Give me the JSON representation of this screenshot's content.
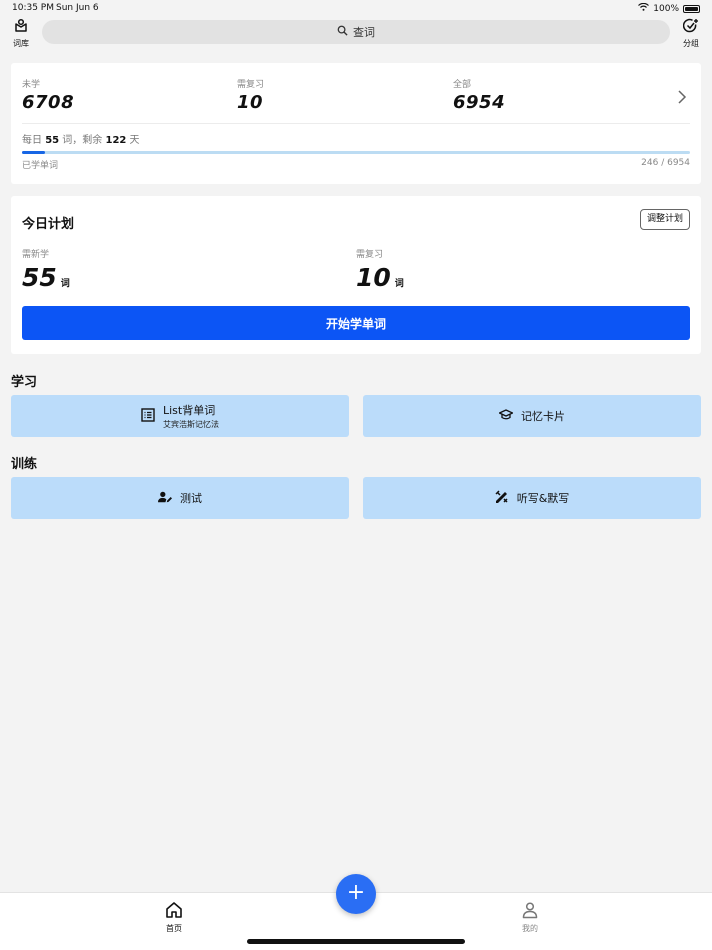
{
  "status": {
    "time": "10:35 PM",
    "date": "Sun Jun 6",
    "battery": "100%"
  },
  "topbar": {
    "left_label": "词库",
    "search_placeholder": "查词",
    "right_label": "分组"
  },
  "stats": {
    "unlearned_label": "未学",
    "unlearned_value": "6708",
    "review_label": "需复习",
    "review_value": "10",
    "total_label": "全部",
    "total_value": "6954",
    "daily_prefix": "每日",
    "daily_count": "55",
    "daily_mid": "词，剩余",
    "days_left": "122",
    "daily_suffix": "天",
    "learned_label": "已学单词",
    "learned_count": "246 / 6954",
    "progress_fraction": 0.035
  },
  "plan": {
    "title": "今日计划",
    "adjust_label": "调整计划",
    "new_label": "需新学",
    "new_value": "55",
    "new_unit": "词",
    "review_label": "需复习",
    "review_value": "10",
    "review_unit": "词",
    "start_label": "开始学单词"
  },
  "learn": {
    "title": "学习",
    "list_main": "List背单词",
    "list_sub": "艾宾浩斯记忆法",
    "cards_label": "记忆卡片"
  },
  "train": {
    "title": "训练",
    "test_label": "测试",
    "dictation_label": "听写&默写"
  },
  "nav": {
    "home_label": "首页",
    "fab_label": "+",
    "mine_label": "我的"
  },
  "colors": {
    "primary": "#0c55f5",
    "tile_bg": "#bbdcfa",
    "progress_fill": "#1766e5",
    "fab": "#2a6ef4"
  }
}
